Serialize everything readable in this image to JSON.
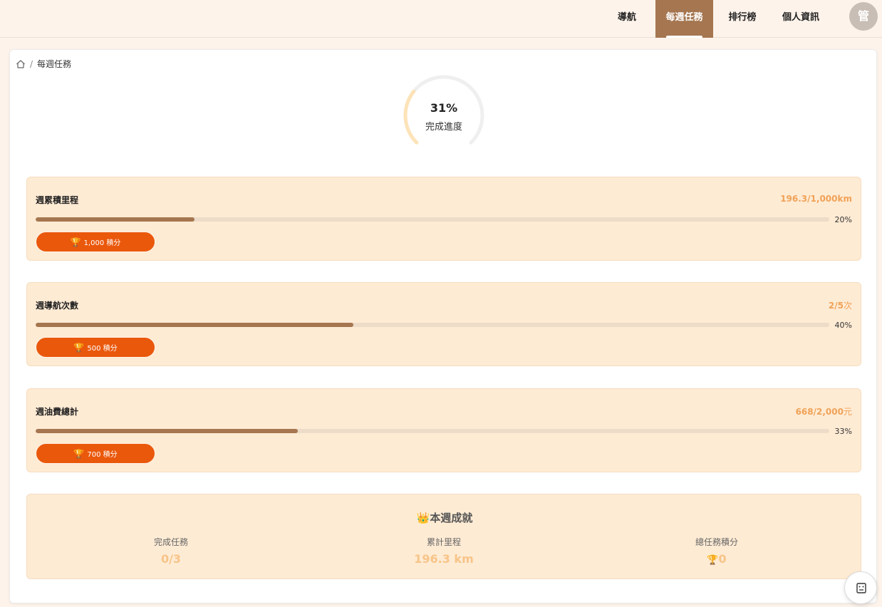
{
  "nav": {
    "items": [
      {
        "label": "導航"
      },
      {
        "label": "每週任務"
      },
      {
        "label": "排行榜"
      },
      {
        "label": "個人資訊"
      }
    ],
    "avatar_text": "管"
  },
  "breadcrumb": {
    "home_icon": "home-icon",
    "separator": "/",
    "current": "每週任務"
  },
  "progress": {
    "percent_text": "31%",
    "percent": 31,
    "label": "完成進度"
  },
  "tasks": [
    {
      "title": "週累積里程",
      "current": "196.3",
      "target": "1,000",
      "unit": "km",
      "percent": 20,
      "percent_text": "20%",
      "reward_text": "1,000 積分"
    },
    {
      "title": "週導航次數",
      "current": "2",
      "target": "5",
      "unit": "次",
      "percent": 40,
      "percent_text": "40%",
      "reward_text": "500 積分"
    },
    {
      "title": "週油費總計",
      "current": "668",
      "target": "2,000",
      "unit": "元",
      "percent": 33,
      "percent_text": "33%",
      "reward_text": "700 積分"
    }
  ],
  "summary": {
    "title": "本週成就",
    "stats": [
      {
        "label": "完成任務",
        "value": "0/3"
      },
      {
        "label": "累計里程",
        "value": "196.3 km"
      },
      {
        "label": "總任務積分",
        "value": "0"
      }
    ]
  },
  "colors": {
    "brand": "#a57650",
    "accent": "#ea580c",
    "value_orange": "#f0a257",
    "task_bg": "#feebd4"
  }
}
